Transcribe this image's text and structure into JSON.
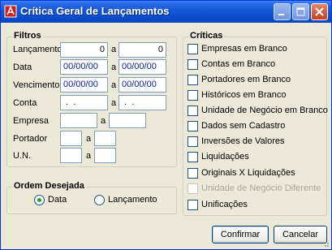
{
  "window": {
    "title": "Crítica Geral de Lançamentos",
    "buttons": [
      "minimize-icon",
      "maximize-icon",
      "close-icon"
    ]
  },
  "filtros": {
    "title": "Filtros",
    "separator": "a",
    "lancamento": {
      "label": "Lançamento",
      "from": "0",
      "to": "0"
    },
    "data": {
      "label": "Data",
      "from": "00/00/00",
      "to": "00/00/00"
    },
    "vencimento": {
      "label": "Vencimento",
      "from": "00/00/00",
      "to": "00/00/00"
    },
    "conta": {
      "label": "Conta",
      "from": " .  . ",
      "to": " .  . "
    },
    "empresa": {
      "label": "Empresa",
      "from": "",
      "to": ""
    },
    "portador": {
      "label": "Portador",
      "from": "",
      "to": ""
    },
    "un": {
      "label": "U.N.",
      "from": "",
      "to": ""
    }
  },
  "ordem": {
    "title": "Ordem Desejada",
    "options": [
      {
        "label": "Data",
        "selected": true
      },
      {
        "label": "Lançamento",
        "selected": false
      }
    ]
  },
  "criticas": {
    "title": "Críticas",
    "items": [
      {
        "label": "Empresas em Branco",
        "enabled": true,
        "checked": false
      },
      {
        "label": "Contas em Branco",
        "enabled": true,
        "checked": false
      },
      {
        "label": "Portadores em Branco",
        "enabled": true,
        "checked": false
      },
      {
        "label": "Históricos em Branco",
        "enabled": true,
        "checked": false
      },
      {
        "label": "Unidade de Negócio em Branco",
        "enabled": true,
        "checked": false
      },
      {
        "label": "Dados sem Cadastro",
        "enabled": true,
        "checked": false
      },
      {
        "label": "Inversões de Valores",
        "enabled": true,
        "checked": false
      },
      {
        "label": "Liquidações",
        "enabled": true,
        "checked": false
      },
      {
        "label": "Originais X Liquidações",
        "enabled": true,
        "checked": false
      },
      {
        "label": "Unidade de Negócio Diferente",
        "enabled": false,
        "checked": false
      },
      {
        "label": "Unificações",
        "enabled": true,
        "checked": false
      }
    ]
  },
  "actions": {
    "confirm_label": "Confirmar",
    "cancel_label": "Cancelar"
  },
  "colors": {
    "titlebar": "#0a4ac8",
    "window_bg": "#ece9d8",
    "field_border": "#7f9db9",
    "date_text": "#0b23a0",
    "disabled_text": "#aca899"
  }
}
